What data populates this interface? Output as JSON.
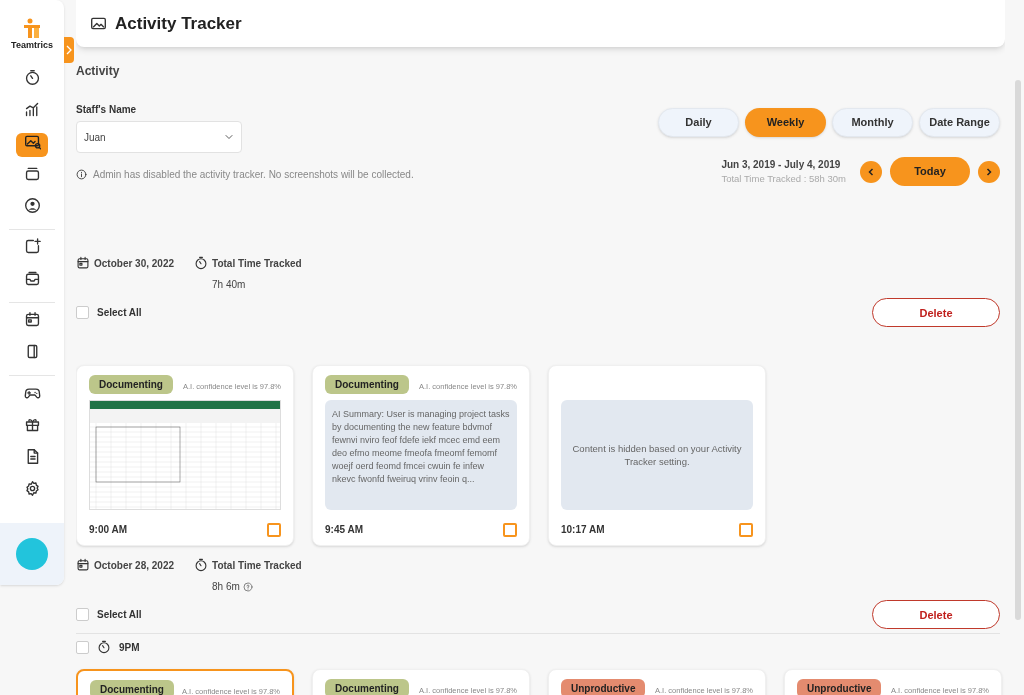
{
  "sidebar": {
    "logo_text": "Teamtrics",
    "groups": [
      [
        {
          "selected": false
        },
        {
          "selected": false
        },
        {
          "selected": true
        },
        {
          "selected": false
        },
        {
          "selected": false
        }
      ],
      [
        {
          "selected": false
        },
        {
          "selected": false
        }
      ],
      [
        {
          "selected": false
        },
        {
          "selected": false
        }
      ],
      [
        {
          "selected": false
        },
        {
          "selected": false
        },
        {
          "selected": false
        },
        {
          "selected": false
        }
      ]
    ]
  },
  "header": {
    "title": "Activity Tracker"
  },
  "section_title": "Activity",
  "staff": {
    "label": "Staff's Name",
    "value": "Juan"
  },
  "notice": "Admin has disabled the activity tracker. No screenshots will be collected.",
  "period_tabs": [
    {
      "label": "Daily",
      "selected": false
    },
    {
      "label": "Weekly",
      "selected": true
    },
    {
      "label": "Monthly",
      "selected": false
    },
    {
      "label": "Date Range",
      "selected": false
    }
  ],
  "range": {
    "dates": "Jun 3, 2019 - July 4, 2019",
    "total": "Total Time Tracked : 58h 30m",
    "today": "Today"
  },
  "days": [
    {
      "date": "October 30, 2022",
      "total_label": "Total Time Tracked",
      "total": "7h 40m",
      "help": false,
      "select_all": "Select All",
      "select_all_checked": false,
      "delete": "Delete",
      "cards": [
        {
          "tag": "Documenting",
          "color": "#bcc68a",
          "confidence": "A.I. confidence level is 97.8%",
          "kind": "screenshot",
          "time": "9:00 AM",
          "checked": false,
          "highlighted": false
        },
        {
          "tag": "Documenting",
          "color": "#bcc68a",
          "confidence": "A.I. confidence level is 97.8%",
          "kind": "summary",
          "text": "AI Summary: User is managing  project tasks by documenting the new feature bdvmof fewnvi nviro feof fdefe iekf mcec emd eem deo efmo meome fmeofa fmeomf femomf woejf oerd feomd fmcei cwuin fe infew nkevc fwonfd fweiruq vrinv feoin q...",
          "time": "9:45 AM",
          "checked": false,
          "highlighted": false
        },
        {
          "kind": "hidden",
          "text": "Content is hidden based on your Activity Tracker setting.",
          "time": "10:17 AM",
          "checked": false,
          "highlighted": false
        }
      ]
    },
    {
      "date": "October 28, 2022",
      "total_label": "Total Time Tracked",
      "total": "8h 6m",
      "help": true,
      "select_all": "Select All",
      "select_all_checked": false,
      "delete": "Delete",
      "hour": {
        "label": "9PM",
        "checked": false
      },
      "cards": [
        {
          "tag": "Documenting",
          "color": "#bcc68a",
          "confidence": "A.I. confidence level is 97.8%",
          "kind": "cut",
          "highlighted": true
        },
        {
          "tag": "Documenting",
          "color": "#bcc68a",
          "confidence": "A.I. confidence level is 97.8%",
          "kind": "cut",
          "highlighted": false
        },
        {
          "tag": "Unproductive",
          "color": "#e48b6f",
          "confidence": "A.I. confidence level is 97.8%",
          "kind": "cut",
          "highlighted": false
        },
        {
          "tag": "Unproductive",
          "color": "#e48b6f",
          "confidence": "A.I. confidence level is 97.8%",
          "kind": "cut",
          "highlighted": false
        }
      ]
    }
  ]
}
